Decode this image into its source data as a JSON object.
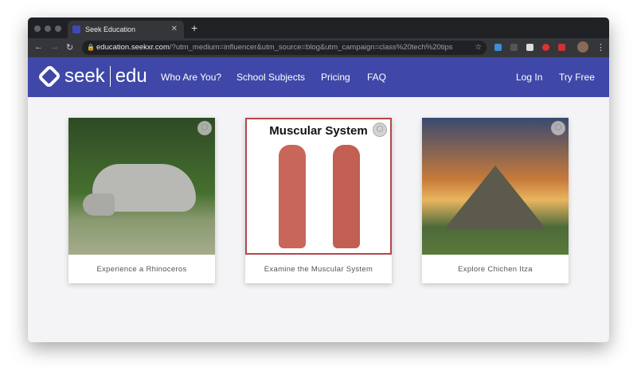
{
  "browser": {
    "tab_title": "Seek Education",
    "url_host": "education.seekxr.com",
    "url_rest": "/?utm_medium=influencer&utm_source=blog&utm_campaign=class%20tech%20tips"
  },
  "site": {
    "logo_seek": "seek",
    "logo_edu": "edu",
    "brand_color": "#3f48a8",
    "nav": [
      "Who Are You?",
      "School Subjects",
      "Pricing",
      "FAQ"
    ],
    "login": "Log In",
    "try_free": "Try Free"
  },
  "cards": [
    {
      "caption": "Experience a Rhinoceros"
    },
    {
      "caption": "Examine the Muscular System",
      "image_title": "Muscular System"
    },
    {
      "caption": "Explore Chichen Itza"
    }
  ]
}
